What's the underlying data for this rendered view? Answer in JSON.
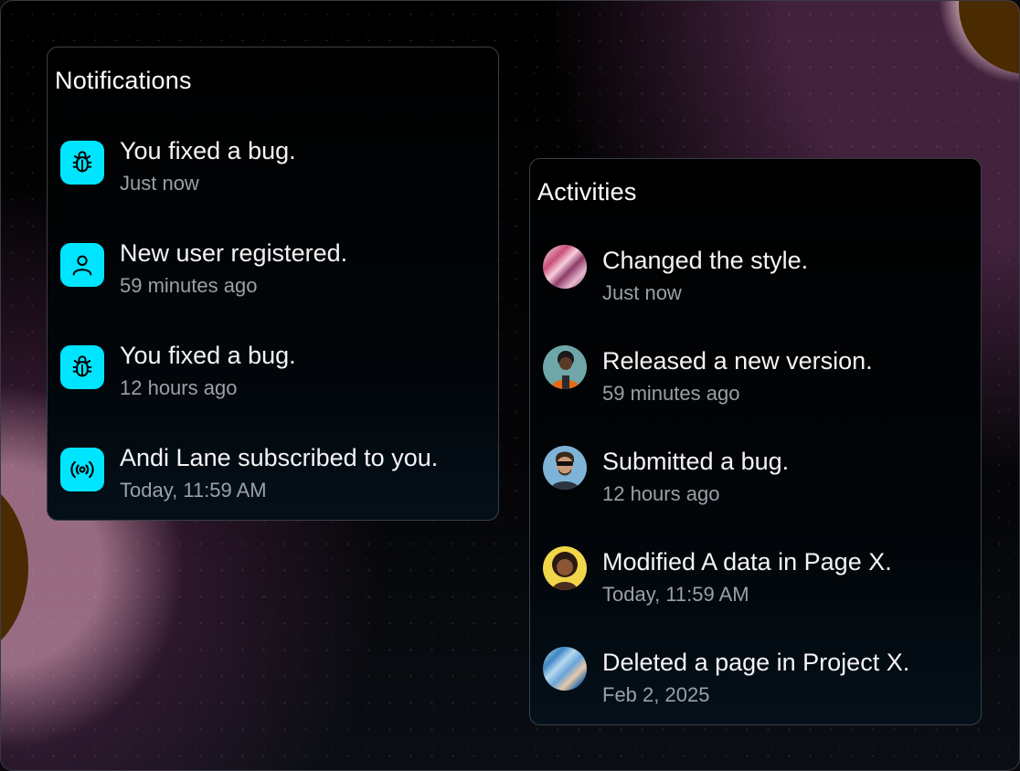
{
  "notifications": {
    "title": "Notifications",
    "items": [
      {
        "icon": "bug-icon",
        "title": "You fixed a bug.",
        "time": "Just now"
      },
      {
        "icon": "user-icon",
        "title": "New user registered.",
        "time": "59 minutes ago"
      },
      {
        "icon": "bug-icon",
        "title": "You fixed a bug.",
        "time": "12 hours ago"
      },
      {
        "icon": "broadcast-icon",
        "title": "Andi Lane subscribed to you.",
        "time": "Today, 11:59 AM"
      }
    ]
  },
  "activities": {
    "title": "Activities",
    "items": [
      {
        "avatar": "abstract-pink-avatar",
        "title": "Changed the style.",
        "time": "Just now"
      },
      {
        "avatar": "person-orange-jacket-avatar",
        "title": "Released a new version.",
        "time": "59 minutes ago"
      },
      {
        "avatar": "person-sunglasses-avatar",
        "title": "Submitted a bug.",
        "time": "12 hours ago"
      },
      {
        "avatar": "person-curly-hair-avatar",
        "title": "Modified A data in Page X.",
        "time": "Today, 11:59 AM"
      },
      {
        "avatar": "abstract-blue-avatar",
        "title": "Deleted a page in Project X.",
        "time": "Feb 2, 2025"
      }
    ]
  },
  "colors": {
    "accent": "#00e5ff",
    "panel_border": "#3b3f47",
    "muted_text": "#9aa0a8",
    "orb": "#4a2a00"
  }
}
